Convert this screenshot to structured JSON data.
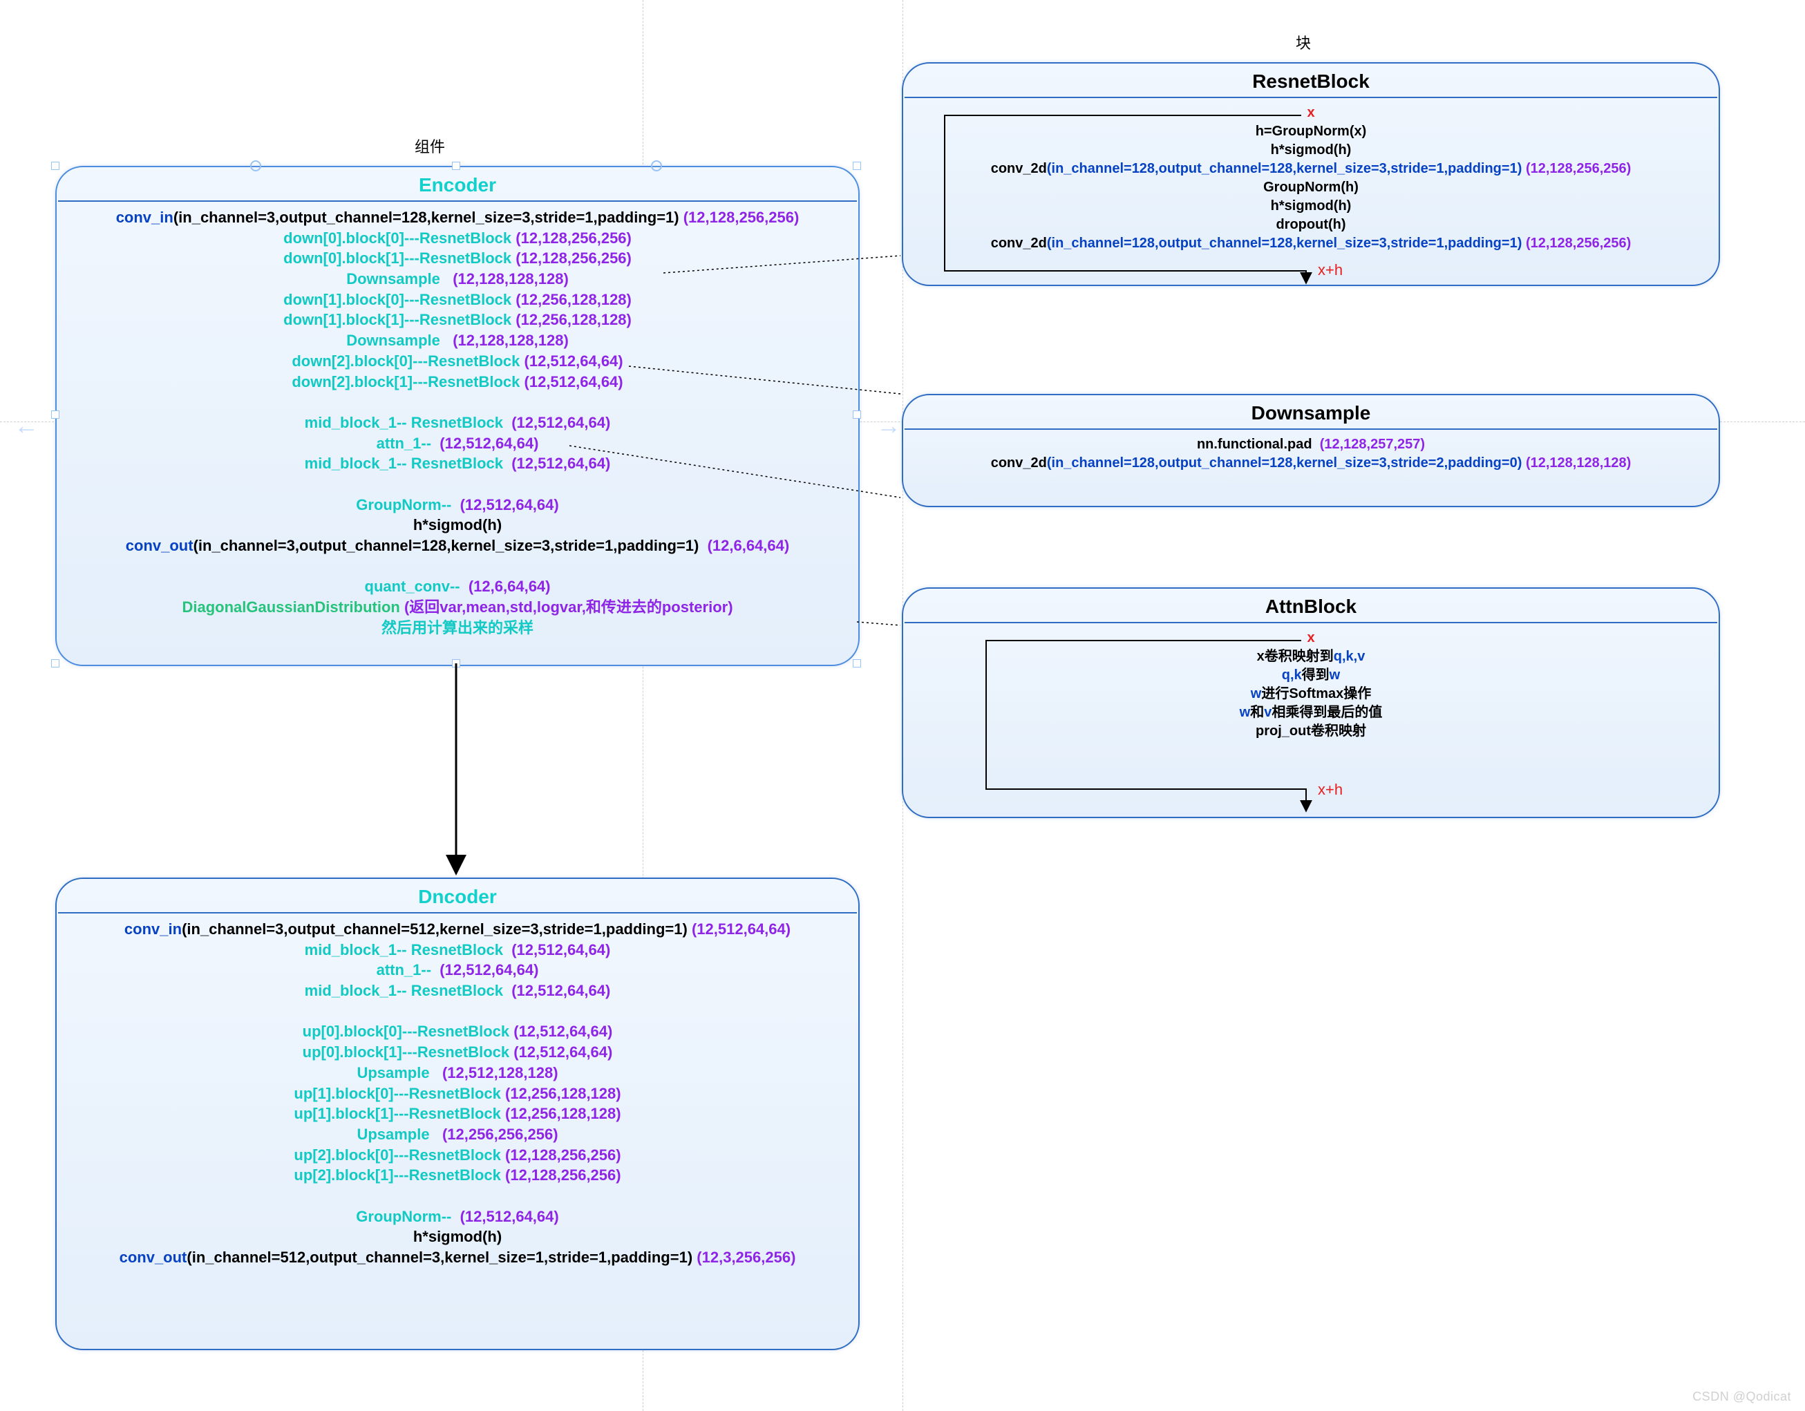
{
  "labels": {
    "components": "组件",
    "block_label": "块",
    "watermark": "CSDN @Qodicat"
  },
  "encoder": {
    "title": "Encoder",
    "conv_in_prefix": "conv_in",
    "conv_in_args": "(in_channel=3,output_channel=128,kernel_size=3,stride=1,padding=1)",
    "conv_in_shape": "(12,128,256,256)",
    "down00_label": "down[0].block[0]---ResnetBlock",
    "down00_shape": "(12,128,256,256)",
    "down01_label": "down[0].block[1]---ResnetBlock",
    "down01_shape": "(12,128,256,256)",
    "downsample1_label": "Downsample",
    "downsample1_shape": "(12,128,128,128)",
    "down10_label": "down[1].block[0]---ResnetBlock",
    "down10_shape": "(12,256,128,128)",
    "down11_label": "down[1].block[1]---ResnetBlock",
    "down11_shape": "(12,256,128,128)",
    "downsample2_label": "Downsample",
    "downsample2_shape": "(12,128,128,128)",
    "down20_label": "down[2].block[0]---ResnetBlock",
    "down20_shape": "(12,512,64,64)",
    "down21_label": "down[2].block[1]---ResnetBlock",
    "down21_shape": "(12,512,64,64)",
    "mid1_label": "mid_block_1-- ResnetBlock",
    "mid1_shape": "(12,512,64,64)",
    "attn1_label": "attn_1--",
    "attn1_shape": "(12,512,64,64)",
    "mid2_label": "mid_block_1-- ResnetBlock",
    "mid2_shape": "(12,512,64,64)",
    "groupnorm_label": "GroupNorm--",
    "groupnorm_shape": "(12,512,64,64)",
    "hsigmod": "h*sigmod(h)",
    "conv_out_prefix": "conv_out",
    "conv_out_args": "(in_channel=3,output_channel=128,kernel_size=3,stride=1,padding=1)",
    "conv_out_shape": "(12,6,64,64)",
    "quant_label": "quant_conv--",
    "quant_shape": "(12,6,64,64)",
    "dgd_prefix": "DiagonalGaussianDistribution",
    "dgd_suffix": "(返回var,mean,std,logvar,和传进去的posterior)",
    "sample_line": "然后用计算出来的采样"
  },
  "dncoder": {
    "title": "Dncoder",
    "conv_in_prefix": "conv_in",
    "conv_in_args": "(in_channel=3,output_channel=512,kernel_size=3,stride=1,padding=1)",
    "conv_in_shape": "(12,512,64,64)",
    "mid1_label": "mid_block_1-- ResnetBlock",
    "mid1_shape": "(12,512,64,64)",
    "attn1_label": "attn_1--",
    "attn1_shape": "(12,512,64,64)",
    "mid2_label": "mid_block_1-- ResnetBlock",
    "mid2_shape": "(12,512,64,64)",
    "up00_label": "up[0].block[0]---ResnetBlock",
    "up00_shape": "(12,512,64,64)",
    "up01_label": "up[0].block[1]---ResnetBlock",
    "up01_shape": "(12,512,64,64)",
    "upsample1_label": "Upsample",
    "upsample1_shape": "(12,512,128,128)",
    "up10_label": "up[1].block[0]---ResnetBlock",
    "up10_shape": "(12,256,128,128)",
    "up11_label": "up[1].block[1]---ResnetBlock",
    "up11_shape": "(12,256,128,128)",
    "upsample2_label": "Upsample",
    "upsample2_shape": "(12,256,256,256)",
    "up20_label": "up[2].block[0]---ResnetBlock",
    "up20_shape": "(12,128,256,256)",
    "up21_label": "up[2].block[1]---ResnetBlock",
    "up21_shape": "(12,128,256,256)",
    "groupnorm_label": "GroupNorm--",
    "groupnorm_shape": "(12,512,64,64)",
    "hsigmod": "h*sigmod(h)",
    "conv_out_prefix": "conv_out",
    "conv_out_args": "(in_channel=512,output_channel=3,kernel_size=1,stride=1,padding=1)",
    "conv_out_shape": "(12,3,256,256)"
  },
  "resnet": {
    "title": "ResnetBlock",
    "x": "x",
    "l1": "h=GroupNorm(x)",
    "l2": "h*sigmod(h)",
    "conv1_prefix": "conv_2d",
    "conv1_args": "(in_channel=128,output_channel=128,kernel_size=3,stride=1,padding=1)",
    "conv1_shape": "(12,128,256,256)",
    "l4": "GroupNorm(h)",
    "l5": "h*sigmod(h)",
    "l6": "dropout(h)",
    "conv2_prefix": "conv_2d",
    "conv2_args": "(in_channel=128,output_channel=128,kernel_size=3,stride=1,padding=1)",
    "conv2_shape": "(12,128,256,256)",
    "xh": "x+h"
  },
  "downsample": {
    "title": "Downsample",
    "pad_label": "nn.functional.pad",
    "pad_shape": "(12,128,257,257)",
    "conv_prefix": "conv_2d",
    "conv_args": "(in_channel=128,output_channel=128,kernel_size=3,stride=2,padding=0)",
    "conv_shape": "(12,128,128,128)"
  },
  "attn": {
    "title": "AttnBlock",
    "x": "x",
    "l1_prefix": "x卷积映射到",
    "l1_suffix": "q,k,v",
    "l2_prefix": "q,k",
    "l2_mid": "得到",
    "l2_suffix": "w",
    "l3_prefix": "w",
    "l3_suffix": "进行Softmax操作",
    "l4_prefix": "w",
    "l4_mid": "和",
    "l4_mid2": "v",
    "l4_suffix": "相乘得到最后的值",
    "l5": "proj_out卷积映射",
    "xh": "x+h"
  }
}
